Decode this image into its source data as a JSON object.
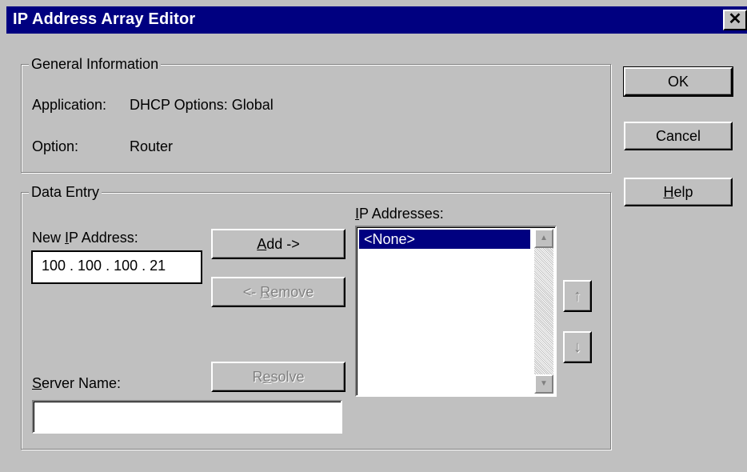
{
  "window": {
    "title": "IP Address Array Editor",
    "close_glyph": "✕"
  },
  "buttons": {
    "ok": "OK",
    "cancel": "Cancel",
    "help_mnemonic": "H",
    "help_rest": "elp"
  },
  "general": {
    "legend": "General Information",
    "application_label": "Application:",
    "application_value": "DHCP Options: Global",
    "option_label": "Option:",
    "option_value": "Router"
  },
  "data_entry": {
    "legend": "Data Entry",
    "new_ip_label_pre": "New ",
    "new_ip_label_mnemonic": "I",
    "new_ip_label_post": "P Address:",
    "new_ip_value": "100 . 100 . 100 .  21",
    "add_mnemonic": "A",
    "add_rest": "dd ->",
    "remove_pre": "<- ",
    "remove_mnemonic": "R",
    "remove_rest": "emove",
    "resolve_pre": "R",
    "resolve_mnemonic": "e",
    "resolve_rest": "solve",
    "server_label_mnemonic": "S",
    "server_label_rest": "erver Name:",
    "server_value": "",
    "ip_list_label_pre": "I",
    "ip_list_label_mnemonic": "P",
    "ip_list_label_post": " Addresses:",
    "ip_list_items": [
      "<None>"
    ],
    "move_up_glyph": "↑",
    "move_down_glyph": "↓"
  },
  "icons": {
    "close": "close-icon",
    "move_up": "arrow-up-icon",
    "move_down": "arrow-down-icon",
    "scroll_up": "scroll-up-icon",
    "scroll_down": "scroll-down-icon"
  },
  "colors": {
    "titlebar": "#000080",
    "face": "#c0c0c0",
    "selection": "#000080"
  }
}
